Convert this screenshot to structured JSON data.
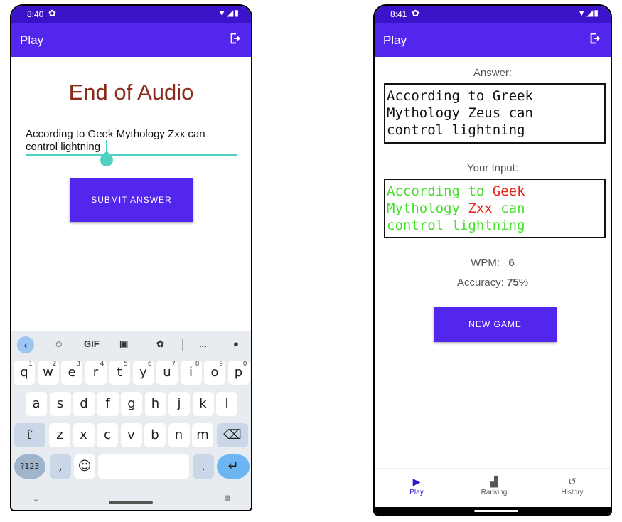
{
  "left_screen": {
    "status": {
      "time": "8:40"
    },
    "appbar": {
      "title": "Play"
    },
    "heading": "End of Audio",
    "input_value": "According to Geek Mythology Zxx can control lightning",
    "submit_label": "SUBMIT ANSWER",
    "keyboard": {
      "toolbar": [
        "GIF",
        "..."
      ],
      "row1": [
        {
          "k": "q",
          "n": "1"
        },
        {
          "k": "w",
          "n": "2"
        },
        {
          "k": "e",
          "n": "3"
        },
        {
          "k": "r",
          "n": "4"
        },
        {
          "k": "t",
          "n": "5"
        },
        {
          "k": "y",
          "n": "6"
        },
        {
          "k": "u",
          "n": "7"
        },
        {
          "k": "i",
          "n": "8"
        },
        {
          "k": "o",
          "n": "9"
        },
        {
          "k": "p",
          "n": "0"
        }
      ],
      "row2": [
        "a",
        "s",
        "d",
        "f",
        "g",
        "h",
        "j",
        "k",
        "l"
      ],
      "row3": [
        "z",
        "x",
        "c",
        "v",
        "b",
        "n",
        "m"
      ],
      "num_key": "?123",
      "comma": ",",
      "period": "."
    }
  },
  "right_screen": {
    "status": {
      "time": "8:41"
    },
    "appbar": {
      "title": "Play"
    },
    "answer_label": "Answer:",
    "answer_text": "According to Greek\nMythology Zeus can\ncontrol lightning",
    "input_label": "Your Input:",
    "input_words": [
      {
        "w": "According",
        "ok": true
      },
      {
        "w": "to",
        "ok": true
      },
      {
        "w": "Geek",
        "ok": false
      },
      {
        "w": "Mythology",
        "ok": true
      },
      {
        "w": "Zxx",
        "ok": false
      },
      {
        "w": "can",
        "ok": true
      },
      {
        "w": "control",
        "ok": true
      },
      {
        "w": "lightning",
        "ok": true
      }
    ],
    "wpm_label": "WPM:",
    "wpm_value": "6",
    "accuracy_label": "Accuracy:",
    "accuracy_value": "75",
    "accuracy_unit": "%",
    "new_game_label": "NEW GAME",
    "nav": [
      {
        "label": "Play",
        "icon": "play-icon"
      },
      {
        "label": "Ranking",
        "icon": "bar-chart-icon"
      },
      {
        "label": "History",
        "icon": "history-icon"
      }
    ]
  },
  "colors": {
    "primary": "#5326ee",
    "status": "#3b13c9",
    "title_red": "#8b2a1b",
    "correct": "#44e02a",
    "wrong": "#e0261b",
    "accent": "#4fd1bf"
  }
}
